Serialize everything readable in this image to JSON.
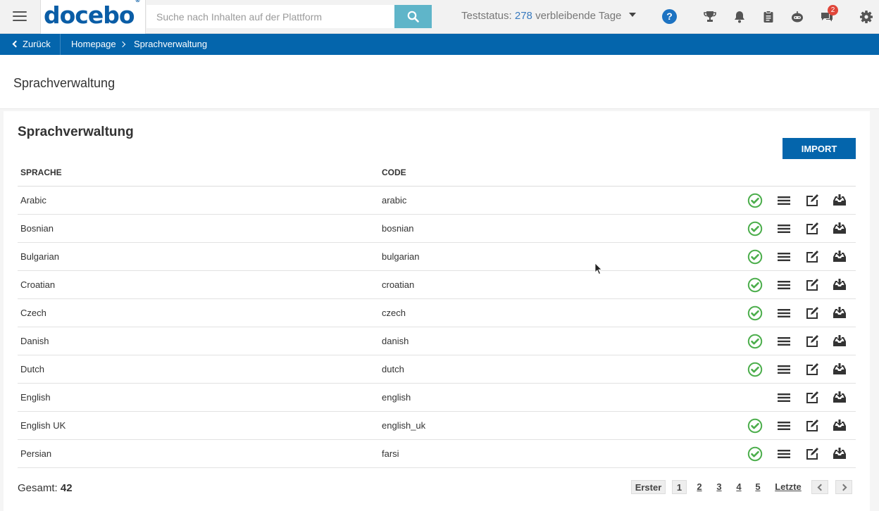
{
  "header": {
    "logo_text": "docebo",
    "logo_mark": "®",
    "search_placeholder": "Suche nach Inhalten auf der Plattform",
    "trial_label": "Teststatus:",
    "trial_days": "278",
    "trial_suffix": "verbleibende Tage",
    "help_label": "?",
    "messages_badge": "2",
    "icons": [
      "menu-icon",
      "search-icon",
      "help-icon",
      "trophy-icon",
      "bell-icon",
      "clipboard-icon",
      "bot-icon",
      "chat-icon",
      "gear-icon"
    ]
  },
  "breadcrumb": {
    "back_label": "Zurück",
    "home_label": "Homepage",
    "current_label": "Sprachverwaltung"
  },
  "page": {
    "title": "Sprachverwaltung"
  },
  "panel": {
    "title": "Sprachverwaltung",
    "import_label": "IMPORT",
    "columns": {
      "language": "SPRACHE",
      "code": "CODE"
    },
    "rows": [
      {
        "language": "Arabic",
        "code": "arabic",
        "active": true
      },
      {
        "language": "Bosnian",
        "code": "bosnian",
        "active": true
      },
      {
        "language": "Bulgarian",
        "code": "bulgarian",
        "active": true
      },
      {
        "language": "Croatian",
        "code": "croatian",
        "active": true
      },
      {
        "language": "Czech",
        "code": "czech",
        "active": true
      },
      {
        "language": "Danish",
        "code": "danish",
        "active": true
      },
      {
        "language": "Dutch",
        "code": "dutch",
        "active": true
      },
      {
        "language": "English",
        "code": "english",
        "active": false
      },
      {
        "language": "English UK",
        "code": "english_uk",
        "active": true
      },
      {
        "language": "Persian",
        "code": "farsi",
        "active": true
      }
    ],
    "total_label": "Gesamt:",
    "total_value": "42"
  },
  "pagination": {
    "first_label": "Erster",
    "pages": [
      "1",
      "2",
      "3",
      "4",
      "5"
    ],
    "current_page": "1",
    "last_label": "Letzte"
  },
  "colors": {
    "brand_blue": "#0465ac",
    "search_button": "#5fb5c9",
    "active_green": "#4cae4c",
    "badge_red": "#e0463a"
  }
}
